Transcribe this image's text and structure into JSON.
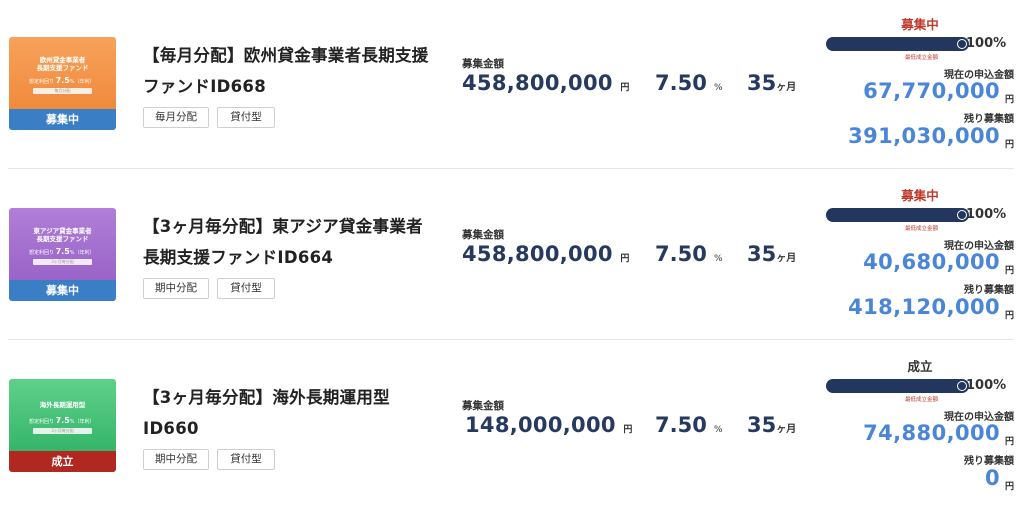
{
  "funds": [
    {
      "thumbnail": {
        "line1": "欧州貸金事業者",
        "line2": "長期支援ファンド",
        "rate_label": "想定利回り",
        "rate_value": "7.5",
        "rate_suffix": "%（年利）",
        "pill_label": "毎月分配",
        "status": "募集中",
        "theme": "orange"
      },
      "title": "【毎月分配】欧州貸金事業者長期支援ファンドID668",
      "tags": [
        "毎月分配",
        "貸付型"
      ],
      "amount_label": "募集金額",
      "amount_value": "458,800,000",
      "amount_unit": "円",
      "rate": "7.50",
      "rate_unit": "%",
      "term": "35",
      "term_unit": "ヶ月",
      "status": "募集中",
      "progress_percent": 100,
      "progress_label": "100%",
      "min_label": "最低成立金額",
      "applied_label": "現在の申込金額",
      "applied_value": "67,770,000",
      "applied_unit": "円",
      "remaining_label": "残り募集額",
      "remaining_value": "391,030,000",
      "remaining_unit": "円"
    },
    {
      "thumbnail": {
        "line1": "東アジア貸金事業者",
        "line2": "長期支援ファンド",
        "rate_label": "想定利回り",
        "rate_value": "7.5",
        "rate_suffix": "%（年利）",
        "pill_label": "3ヶ月毎分配",
        "status": "募集中",
        "theme": "purple"
      },
      "title": "【3ヶ月毎分配】東アジア貸金事業者長期支援ファンドID664",
      "tags": [
        "期中分配",
        "貸付型"
      ],
      "amount_label": "募集金額",
      "amount_value": "458,800,000",
      "amount_unit": "円",
      "rate": "7.50",
      "rate_unit": "%",
      "term": "35",
      "term_unit": "ヶ月",
      "status": "募集中",
      "progress_percent": 100,
      "progress_label": "100%",
      "min_label": "最低成立金額",
      "applied_label": "現在の申込金額",
      "applied_value": "40,680,000",
      "applied_unit": "円",
      "remaining_label": "残り募集額",
      "remaining_value": "418,120,000",
      "remaining_unit": "円"
    },
    {
      "thumbnail": {
        "line1": "海外長期運用型",
        "line2": "",
        "rate_label": "想定利回り",
        "rate_value": "7.5",
        "rate_suffix": "%（年利）",
        "pill_label": "3ヶ月毎分配",
        "status": "成立",
        "theme": "green"
      },
      "title": "【3ヶ月毎分配】海外長期運用型ID660",
      "tags": [
        "期中分配",
        "貸付型"
      ],
      "amount_label": "募集金額",
      "amount_value": "148,000,000",
      "amount_unit": "円",
      "rate": "7.50",
      "rate_unit": "%",
      "term": "35",
      "term_unit": "ヶ月",
      "status": "成立",
      "progress_percent": 100,
      "progress_label": "100%",
      "min_label": "最低成立金額",
      "applied_label": "現在の申込金額",
      "applied_value": "74,880,000",
      "applied_unit": "円",
      "remaining_label": "残り募集額",
      "remaining_value": "0",
      "remaining_unit": "円"
    }
  ],
  "colors": {
    "navy": "#23375e",
    "blue_value": "#4a86d8",
    "status_open": "#c0392b",
    "orange_top": "#f7a25a",
    "orange_bottom": "#f08a3c",
    "purple_top": "#b07fd8",
    "purple_bottom": "#9a63c8",
    "green_top": "#5fd08a",
    "green_bottom": "#35b56a",
    "badge_open": "#3a7ec6",
    "badge_closed": "#b0281f"
  }
}
